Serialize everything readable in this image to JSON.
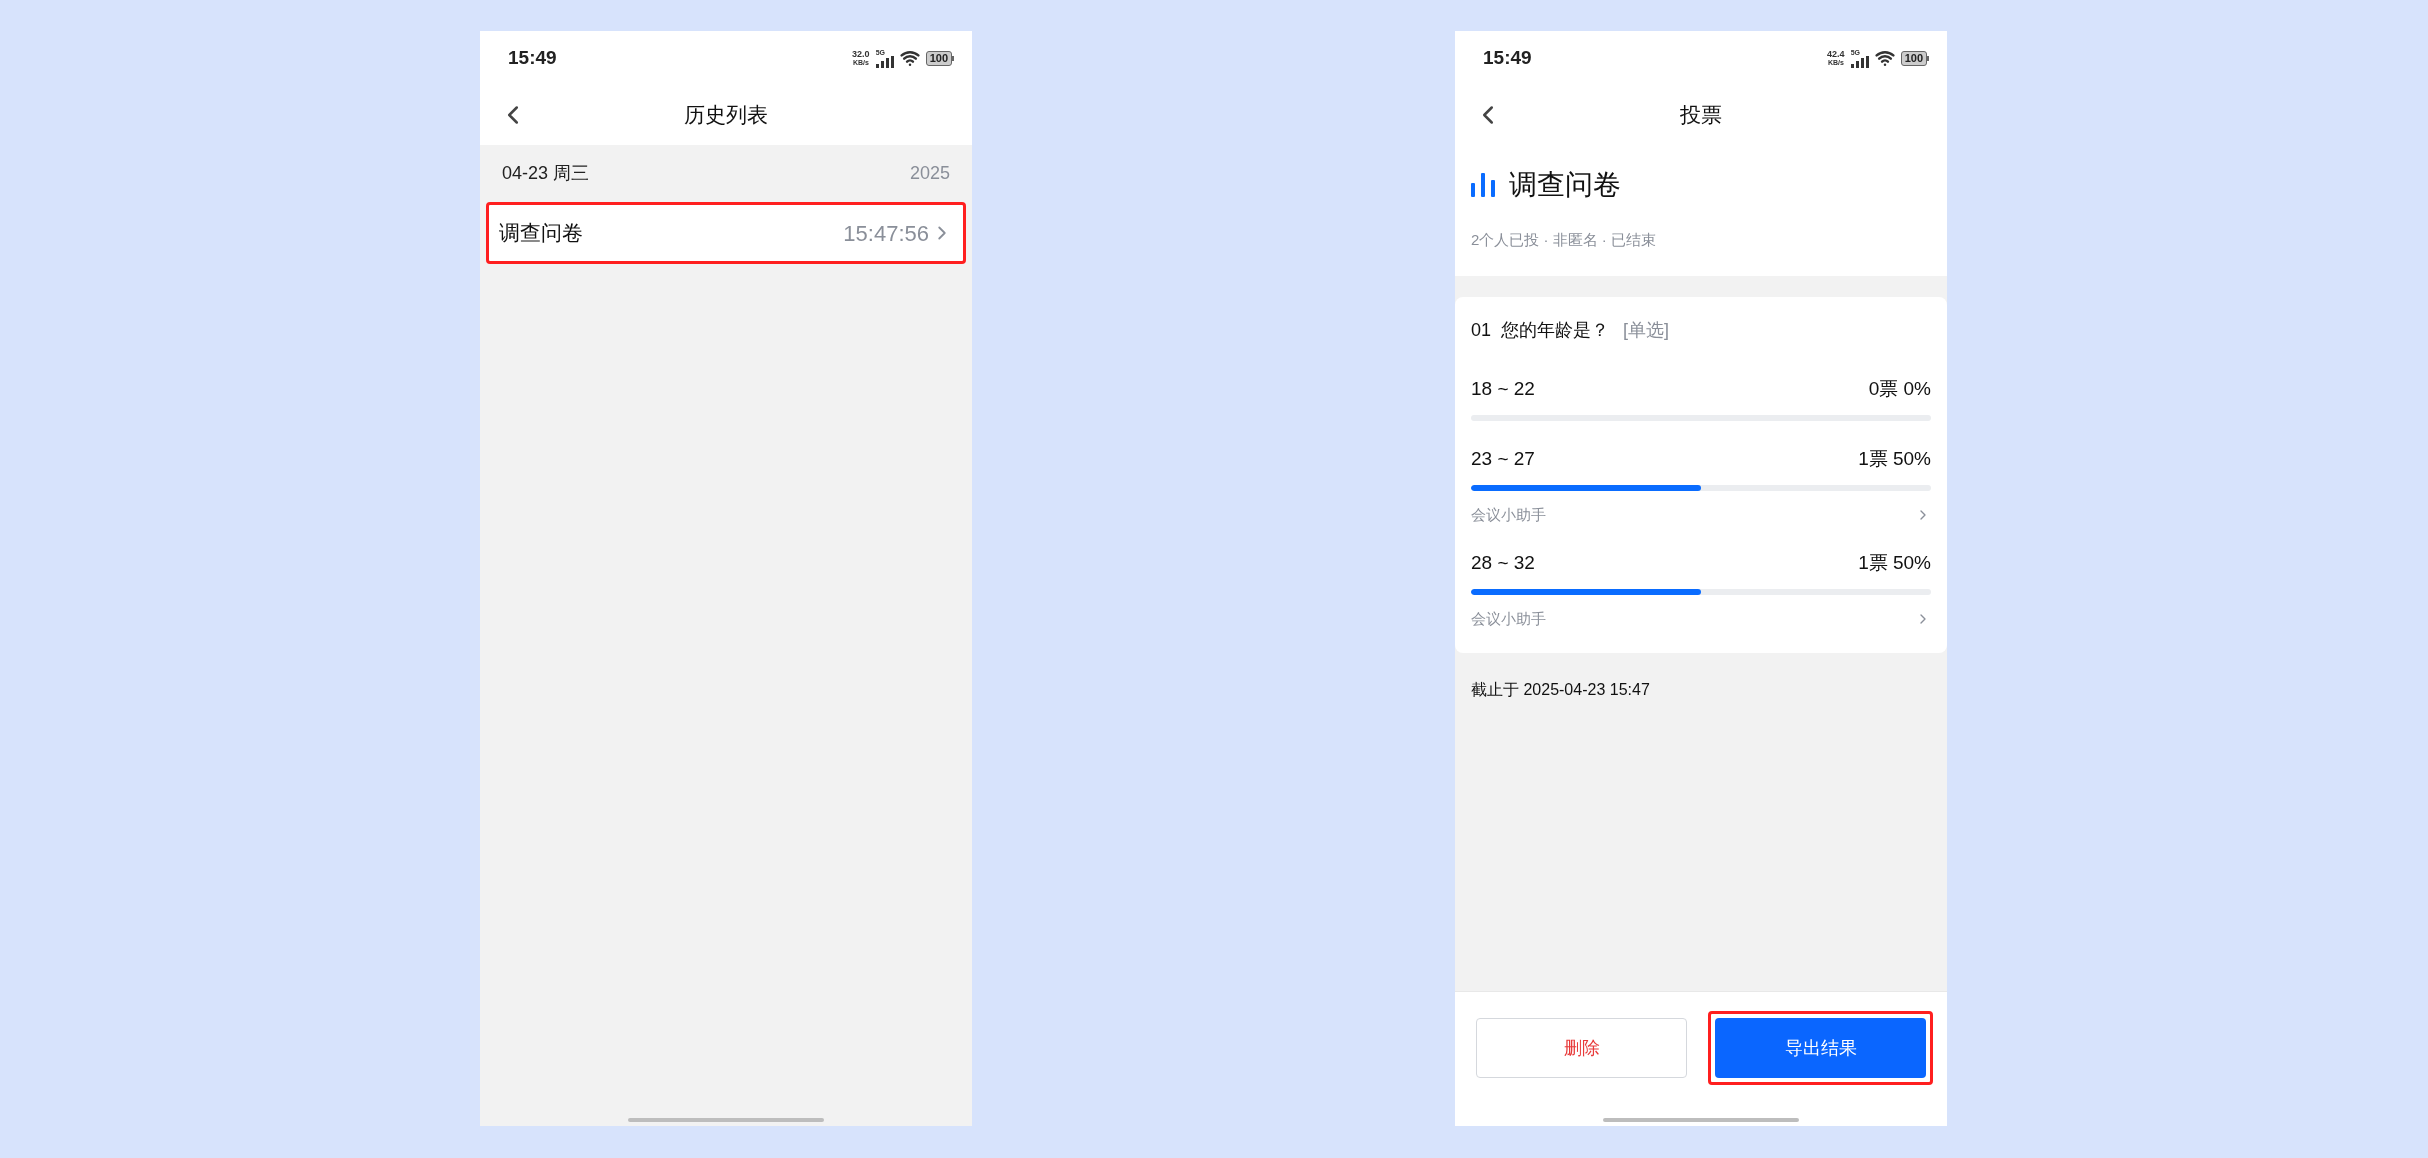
{
  "screens": [
    {
      "kind": "history",
      "status_bar": {
        "time": "15:49",
        "speed": "32.0",
        "speed_unit": "KB/s",
        "network": "5G",
        "battery": "100"
      },
      "nav_title": "历史列表",
      "groups": [
        {
          "date": "04-23 周三",
          "year": "2025",
          "items": [
            {
              "title": "调查问卷",
              "time": "15:47:56",
              "highlighted": true
            }
          ]
        }
      ]
    },
    {
      "kind": "poll",
      "status_bar": {
        "time": "15:49",
        "speed": "42.4",
        "speed_unit": "KB/s",
        "network": "5G",
        "battery": "100"
      },
      "nav_title": "投票",
      "title": "调查问卷",
      "meta": "2个人已投 · 非匿名 · 已结束",
      "question": {
        "number": "01",
        "text": "您的年龄是？",
        "type": "[单选]"
      },
      "options": [
        {
          "label": "18 ~ 22",
          "result": "0票 0%",
          "level": 0
        },
        {
          "label": "23 ~ 27",
          "result": "1票 50%",
          "level": 0.5,
          "voters": [
            "会议小助手"
          ]
        },
        {
          "label": "28 ~ 32",
          "result": "1票 50%",
          "level": 0.5,
          "voters": [
            "会议小助手"
          ]
        }
      ],
      "deadline": "截止于 2025-04-23 15:47",
      "buttons": [
        {
          "label": "删除",
          "kind": "secondary",
          "highlighted": false
        },
        {
          "label": "导出结果",
          "kind": "primary",
          "highlighted": true
        }
      ]
    }
  ]
}
